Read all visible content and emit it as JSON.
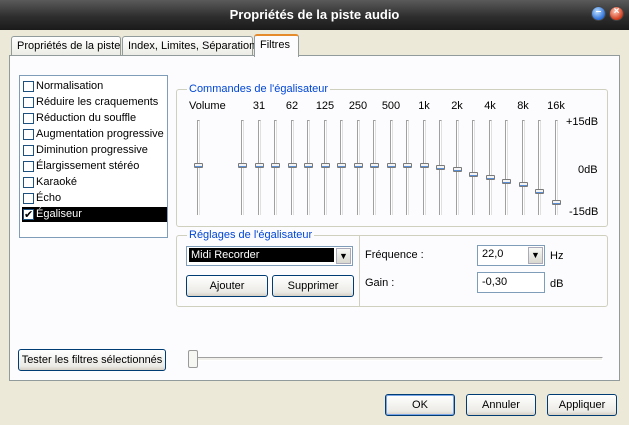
{
  "window": {
    "title": "Propriétés de la piste audio",
    "minimize_glyph": "–",
    "close_glyph": "×"
  },
  "tabs": [
    {
      "label": "Propriétés de la piste"
    },
    {
      "label": "Index, Limites, Séparation"
    },
    {
      "label": "Filtres"
    }
  ],
  "filters": [
    {
      "label": "Normalisation",
      "checked": false
    },
    {
      "label": "Réduire les craquements",
      "checked": false
    },
    {
      "label": "Réduction du souffle",
      "checked": false
    },
    {
      "label": "Augmentation progressive",
      "checked": false
    },
    {
      "label": "Diminution progressive",
      "checked": false
    },
    {
      "label": "Élargissement stéréo",
      "checked": false
    },
    {
      "label": "Karaoké",
      "checked": false
    },
    {
      "label": "Écho",
      "checked": false
    },
    {
      "label": "Égaliseur",
      "checked": true,
      "selected": true
    }
  ],
  "equalizer": {
    "group_label": "Commandes de l'égalisateur",
    "volume_label": "Volume",
    "bands": [
      "31",
      "62",
      "125",
      "250",
      "500",
      "1k",
      "2k",
      "4k",
      "8k",
      "16k"
    ],
    "db_top": "+15dB",
    "db_mid": "0dB",
    "db_bottom": "-15dB",
    "volume_level": 0.52,
    "band_levels": [
      0.52,
      0.52,
      0.52,
      0.52,
      0.52,
      0.52,
      0.52,
      0.52,
      0.52,
      0.52,
      0.52,
      0.52,
      0.5,
      0.47,
      0.42,
      0.38,
      0.34,
      0.3,
      0.22,
      0.1
    ]
  },
  "presets": {
    "group_label": "Réglages de l'égalisateur",
    "selected": "Midi Recorder",
    "add_label": "Ajouter",
    "delete_label": "Supprimer"
  },
  "frequency": {
    "label": "Fréquence :",
    "value": "22,0",
    "unit": "Hz"
  },
  "gain": {
    "label": "Gain :",
    "value": "-0,30",
    "unit": "dB"
  },
  "test_button": "Tester les filtres sélectionnés",
  "dialog_buttons": {
    "ok": "OK",
    "cancel": "Annuler",
    "apply": "Appliquer"
  }
}
